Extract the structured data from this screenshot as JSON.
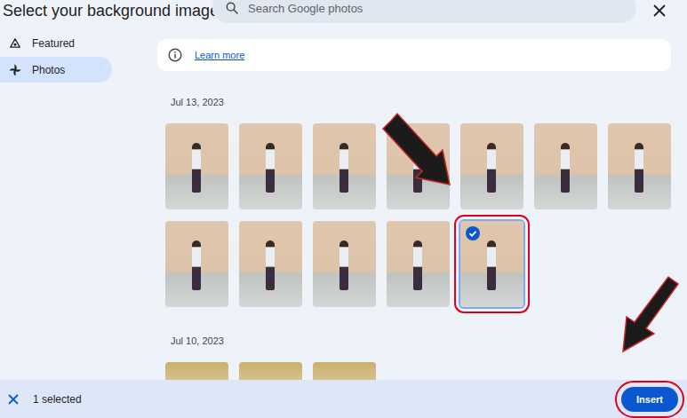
{
  "window": {
    "title": "Select your background image"
  },
  "search": {
    "placeholder": "Search Google photos"
  },
  "sidebar": {
    "items": [
      {
        "label": "Featured",
        "selected": false
      },
      {
        "label": "Photos",
        "selected": true
      }
    ]
  },
  "info": {
    "link": "Learn more"
  },
  "sections": [
    {
      "date": "Jul 13, 2023",
      "photos": [
        {
          "selected": false
        },
        {
          "selected": false
        },
        {
          "selected": false
        },
        {
          "selected": false
        },
        {
          "selected": false
        },
        {
          "selected": false
        },
        {
          "selected": false
        },
        {
          "selected": false
        },
        {
          "selected": false
        },
        {
          "selected": false
        },
        {
          "selected": false
        },
        {
          "selected": true
        }
      ]
    },
    {
      "date": "Jul 10, 2023",
      "photos": [
        {
          "selected": false
        },
        {
          "selected": false
        },
        {
          "selected": false
        }
      ]
    }
  ],
  "selection_bar": {
    "count": "1 selected"
  },
  "buttons": [
    "Insert"
  ]
}
